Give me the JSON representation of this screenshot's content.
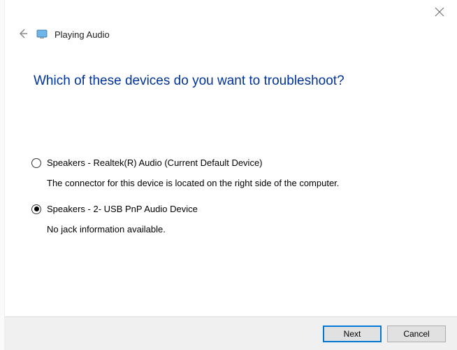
{
  "header": {
    "title": "Playing Audio"
  },
  "main": {
    "heading": "Which of these devices do you want to troubleshoot?",
    "options": [
      {
        "label": "Speakers - Realtek(R) Audio (Current Default Device)",
        "description": "The connector for this device is located on the right side of the computer.",
        "selected": false
      },
      {
        "label": "Speakers - 2- USB PnP Audio Device",
        "description": "No jack information available.",
        "selected": true
      }
    ]
  },
  "footer": {
    "next_label": "Next",
    "cancel_label": "Cancel"
  }
}
